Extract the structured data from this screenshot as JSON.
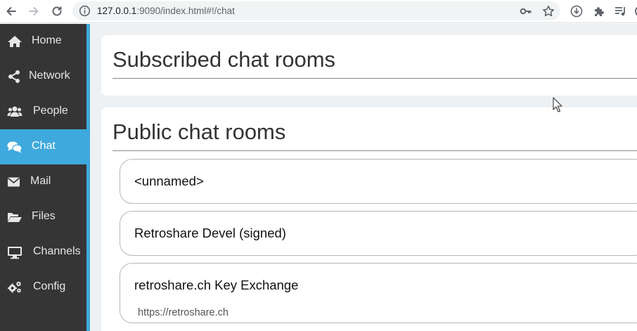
{
  "browser": {
    "url_host": "127.0.0.1",
    "url_rest": ":9090/index.html#!/chat",
    "icons": [
      "back-icon",
      "forward-icon",
      "reload-icon",
      "info-icon",
      "key-icon",
      "star-icon",
      "download-icon",
      "puzzle-icon",
      "playlist-icon"
    ]
  },
  "sidebar": {
    "items": [
      {
        "label": "Home",
        "icon": "home-icon"
      },
      {
        "label": "Network",
        "icon": "share-icon"
      },
      {
        "label": "People",
        "icon": "people-icon"
      },
      {
        "label": "Chat",
        "icon": "chat-icon",
        "active": true
      },
      {
        "label": "Mail",
        "icon": "mail-icon"
      },
      {
        "label": "Files",
        "icon": "folder-icon"
      },
      {
        "label": "Channels",
        "icon": "monitor-icon"
      },
      {
        "label": "Config",
        "icon": "gears-icon"
      }
    ]
  },
  "main": {
    "subscribed_title": "Subscribed chat rooms",
    "public_title": "Public chat rooms",
    "rooms": [
      {
        "name": "<unnamed>",
        "topic": ""
      },
      {
        "name": "Retroshare Devel (signed)",
        "topic": ""
      },
      {
        "name": "retroshare.ch Key Exchange",
        "topic": "https://retroshare.ch"
      }
    ]
  },
  "colors": {
    "sidebar_bg": "#353535",
    "accent": "#3ea9dc",
    "main_bg": "#eef1f3"
  }
}
